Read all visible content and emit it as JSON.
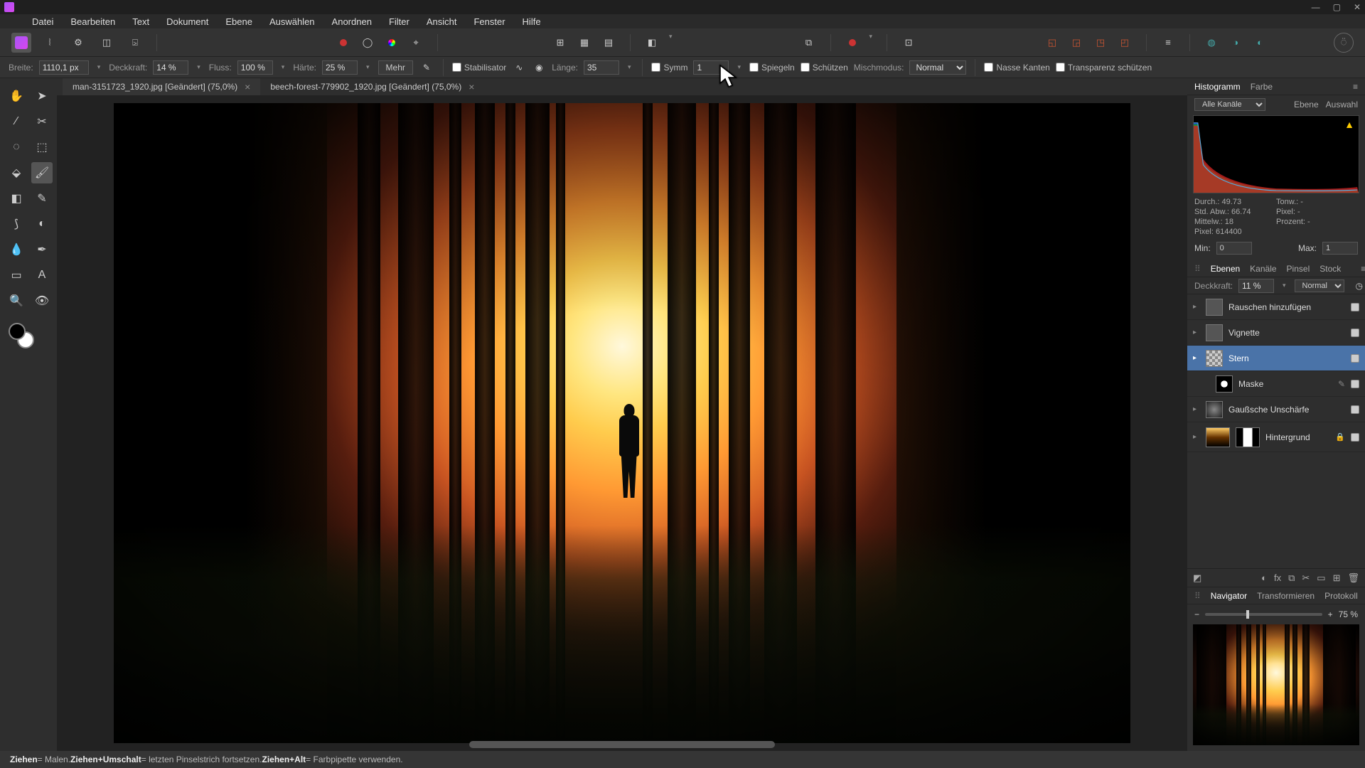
{
  "menu": [
    "Datei",
    "Bearbeiten",
    "Text",
    "Dokument",
    "Ebene",
    "Auswählen",
    "Anordnen",
    "Filter",
    "Ansicht",
    "Fenster",
    "Hilfe"
  ],
  "opts": {
    "width_label": "Breite:",
    "width_val": "1110,1 px",
    "opacity_label": "Deckkraft:",
    "opacity_val": "14 %",
    "flow_label": "Fluss:",
    "flow_val": "100 %",
    "hard_label": "Härte:",
    "hard_val": "25 %",
    "more": "Mehr",
    "stab": "Stabilisator",
    "len_label": "Länge:",
    "len_val": "35",
    "symm": "Symm",
    "symm_val": "1",
    "mirror": "Spiegeln",
    "protect": "Schützen",
    "blend_label": "Mischmodus:",
    "blend_val": "Normal",
    "wet": "Nasse Kanten",
    "trans": "Transparenz schützen"
  },
  "tabs": {
    "t1": "man-3151723_1920.jpg [Geändert] (75,0%)",
    "t2": "beech-forest-779902_1920.jpg [Geändert] (75,0%)"
  },
  "hist": {
    "tab1": "Histogramm",
    "tab2": "Farbe",
    "channels": "Alle Kanäle",
    "t_ebene": "Ebene",
    "t_auswahl": "Auswahl",
    "mean_l": "Durch.:",
    "mean_v": "49.73",
    "std_l": "Std. Abw.:",
    "std_v": "66.74",
    "med_l": "Mittelw.:",
    "med_v": "18",
    "pix_l": "Pixel:",
    "pix_v": "614400",
    "tone_l": "Tonw.:",
    "tone_v": "-",
    "pxl_l": "Pixel:",
    "pxl_v": "-",
    "pct_l": "Prozent:",
    "pct_v": "-",
    "min_l": "Min:",
    "min_v": "0",
    "max_l": "Max:",
    "max_v": "1"
  },
  "layp": {
    "tabs": [
      "Ebenen",
      "Kanäle",
      "Pinsel",
      "Stock"
    ],
    "op_label": "Deckkraft:",
    "op_val": "11 %",
    "mode": "Normal",
    "l1": "Rauschen hinzufügen",
    "l2": "Vignette",
    "l3": "Stern",
    "l4": "Maske",
    "l5": "Gaußsche Unschärfe",
    "l6": "Hintergrund"
  },
  "nav": {
    "tabs": [
      "Navigator",
      "Transformieren",
      "Protokoll"
    ],
    "zoom": "75 %"
  },
  "status": {
    "a": "Ziehen",
    "at": " = Malen. ",
    "b": "Ziehen+Umschalt",
    "bt": " = letzten Pinselstrich fortsetzen. ",
    "c": "Ziehen+Alt",
    "ct": " = Farbpipette verwenden."
  }
}
